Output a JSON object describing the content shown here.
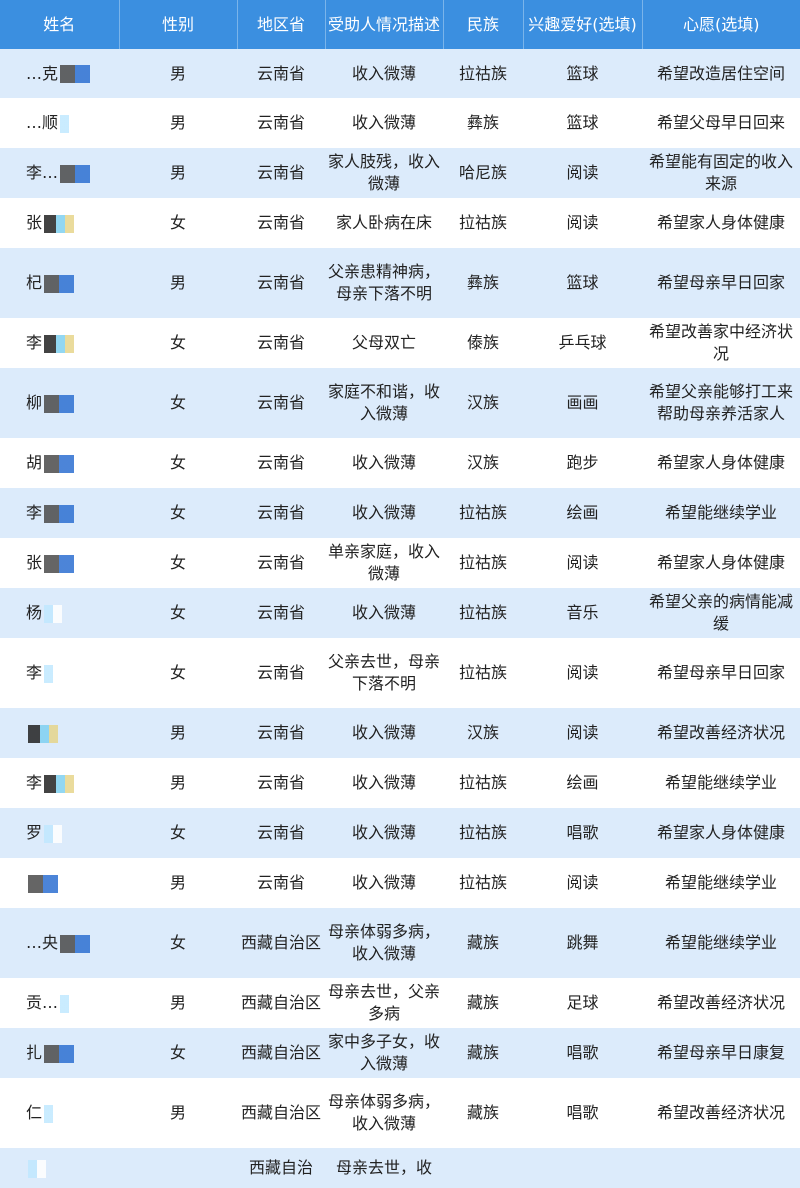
{
  "headers": [
    "姓名",
    "性别",
    "地区省",
    "受助人情况描述",
    "民族",
    "兴趣爱好(选填)",
    "心愿(选填)"
  ],
  "rows": [
    {
      "name": "…克",
      "gender": "男",
      "region": "云南省",
      "desc": "收入微薄",
      "ethnic": "拉祜族",
      "hobby": "篮球",
      "wish": "希望改造居住空间"
    },
    {
      "name": "…顺",
      "gender": "男",
      "region": "云南省",
      "desc": "收入微薄",
      "ethnic": "彝族",
      "hobby": "篮球",
      "wish": "希望父母早日回来"
    },
    {
      "name": "李…",
      "gender": "男",
      "region": "云南省",
      "desc": "家人肢残，收入微薄",
      "ethnic": "哈尼族",
      "hobby": "阅读",
      "wish": "希望能有固定的收入来源"
    },
    {
      "name": "张",
      "gender": "女",
      "region": "云南省",
      "desc": "家人卧病在床",
      "ethnic": "拉祜族",
      "hobby": "阅读",
      "wish": "希望家人身体健康"
    },
    {
      "name": "杞",
      "gender": "男",
      "region": "云南省",
      "desc": "父亲患精神病，母亲下落不明",
      "ethnic": "彝族",
      "hobby": "篮球",
      "wish": "希望母亲早日回家"
    },
    {
      "name": "李",
      "gender": "女",
      "region": "云南省",
      "desc": "父母双亡",
      "ethnic": "傣族",
      "hobby": "乒乓球",
      "wish": "希望改善家中经济状况"
    },
    {
      "name": "柳",
      "gender": "女",
      "region": "云南省",
      "desc": "家庭不和谐，收入微薄",
      "ethnic": "汉族",
      "hobby": "画画",
      "wish": "希望父亲能够打工来帮助母亲养活家人"
    },
    {
      "name": "胡",
      "gender": "女",
      "region": "云南省",
      "desc": "收入微薄",
      "ethnic": "汉族",
      "hobby": "跑步",
      "wish": "希望家人身体健康"
    },
    {
      "name": "李",
      "gender": "女",
      "region": "云南省",
      "desc": "收入微薄",
      "ethnic": "拉祜族",
      "hobby": "绘画",
      "wish": "希望能继续学业"
    },
    {
      "name": "张",
      "gender": "女",
      "region": "云南省",
      "desc": "单亲家庭，收入微薄",
      "ethnic": "拉祜族",
      "hobby": "阅读",
      "wish": "希望家人身体健康"
    },
    {
      "name": "杨",
      "gender": "女",
      "region": "云南省",
      "desc": "收入微薄",
      "ethnic": "拉祜族",
      "hobby": "音乐",
      "wish": "希望父亲的病情能减缓"
    },
    {
      "name": "李",
      "gender": "女",
      "region": "云南省",
      "desc": "父亲去世，母亲下落不明",
      "ethnic": "拉祜族",
      "hobby": "阅读",
      "wish": "希望母亲早日回家"
    },
    {
      "name": "",
      "gender": "男",
      "region": "云南省",
      "desc": "收入微薄",
      "ethnic": "汉族",
      "hobby": "阅读",
      "wish": "希望改善经济状况"
    },
    {
      "name": "李",
      "gender": "男",
      "region": "云南省",
      "desc": "收入微薄",
      "ethnic": "拉祜族",
      "hobby": "绘画",
      "wish": "希望能继续学业"
    },
    {
      "name": "罗",
      "gender": "女",
      "region": "云南省",
      "desc": "收入微薄",
      "ethnic": "拉祜族",
      "hobby": "唱歌",
      "wish": "希望家人身体健康"
    },
    {
      "name": "",
      "gender": "男",
      "region": "云南省",
      "desc": "收入微薄",
      "ethnic": "拉祜族",
      "hobby": "阅读",
      "wish": "希望能继续学业"
    },
    {
      "name": "…央",
      "gender": "女",
      "region": "西藏自治区",
      "desc": "母亲体弱多病，收入微薄",
      "ethnic": "藏族",
      "hobby": "跳舞",
      "wish": "希望能继续学业"
    },
    {
      "name": "贡…",
      "gender": "男",
      "region": "西藏自治区",
      "desc": "母亲去世，父亲多病",
      "ethnic": "藏族",
      "hobby": "足球",
      "wish": "希望改善经济状况"
    },
    {
      "name": "扎",
      "gender": "女",
      "region": "西藏自治区",
      "desc": "家中多子女，收入微薄",
      "ethnic": "藏族",
      "hobby": "唱歌",
      "wish": "希望母亲早日康复"
    },
    {
      "name": "仁",
      "gender": "男",
      "region": "西藏自治区",
      "desc": "母亲体弱多病，收入微薄",
      "ethnic": "藏族",
      "hobby": "唱歌",
      "wish": "希望改善经济状况"
    },
    {
      "name": "",
      "gender": "",
      "region": "西藏自治",
      "desc": "母亲去世，收",
      "ethnic": "",
      "hobby": "",
      "wish": ""
    }
  ]
}
